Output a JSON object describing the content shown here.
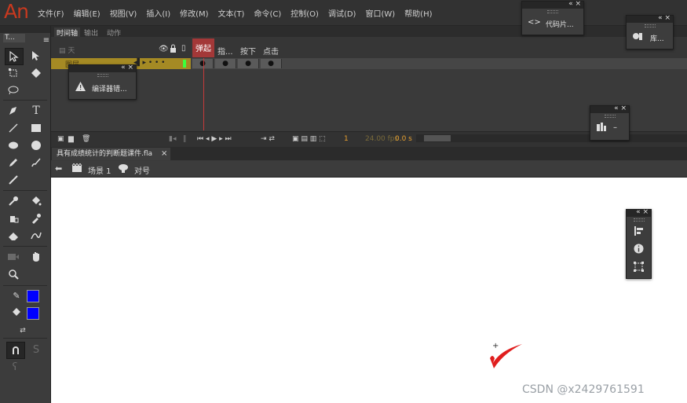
{
  "app": {
    "logo": "An"
  },
  "menu": [
    "文件(F)",
    "编辑(E)",
    "视图(V)",
    "插入(I)",
    "修改(M)",
    "文本(T)",
    "命令(C)",
    "控制(O)",
    "调试(D)",
    "窗口(W)",
    "帮助(H)"
  ],
  "toolbox": {
    "tab_label": "T..."
  },
  "timeline": {
    "tabs": [
      "时间轴",
      "输出",
      "动作"
    ],
    "layer_name": "图层",
    "frame_labels": [
      "弹起",
      "指...",
      "按下",
      "点击"
    ],
    "fps": "24.00 fps",
    "time": "0.0 s",
    "frame_number": "1"
  },
  "document": {
    "tab_title": "具有成绩统计的判断题课件.fla",
    "scene_label": "场景 1",
    "symbol_label": "对号"
  },
  "panels": {
    "code_snippets": "代码片...",
    "compiler_errors": "编译器错...",
    "library_short": "库...",
    "dash": "–"
  },
  "watermark": "CSDN @x2429761591",
  "colors": {
    "fill": "#0000ff",
    "stroke": "#0000ff",
    "playhead": "#a33838",
    "layer_highlight": "#a58a24",
    "checkmark": "#e01e1e"
  }
}
